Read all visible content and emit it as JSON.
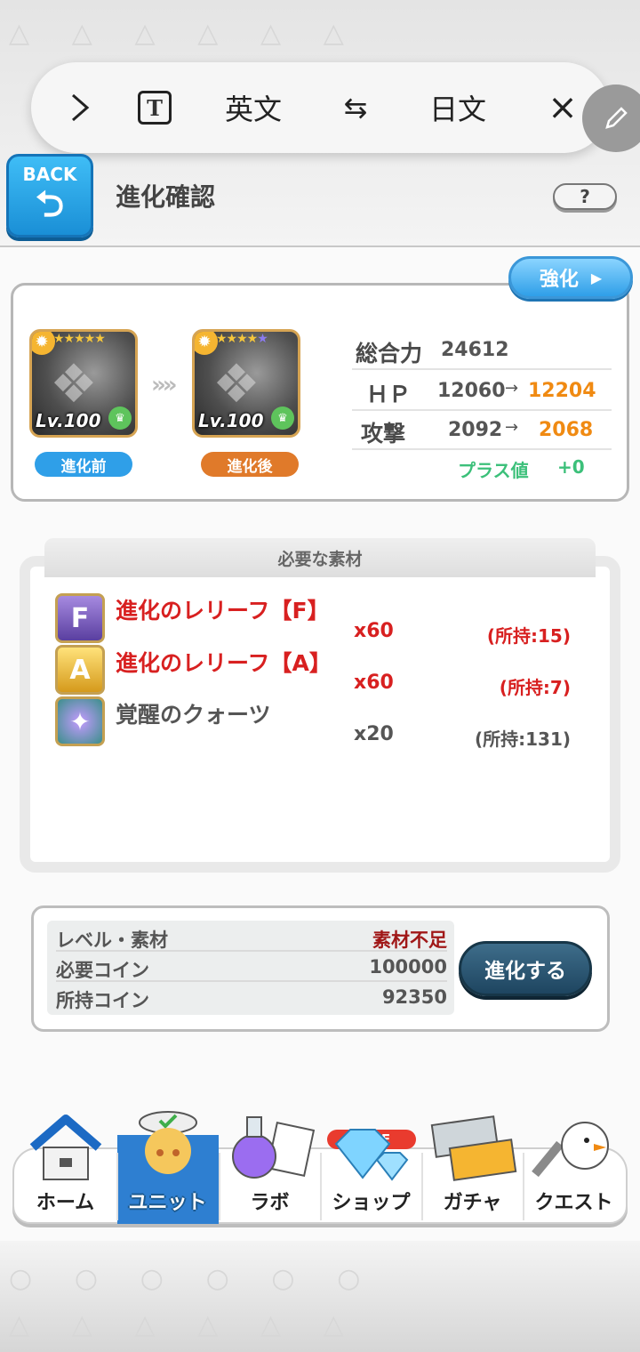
{
  "toolbar": {
    "expand_icon": "chevron-right-icon",
    "text_mode_icon": "T",
    "lang_source": "英文",
    "swap_icon": "⇆",
    "lang_target": "日文",
    "close_icon": "×",
    "edit_icon": "pencil-icon"
  },
  "header": {
    "back_label": "BACK",
    "title": "進化確認",
    "help_label": "?"
  },
  "evolution": {
    "enhance_label": "強化",
    "before": {
      "level": "Lv.100",
      "badge": "進化前"
    },
    "after": {
      "level": "Lv.100",
      "badge": "進化後"
    },
    "stats": {
      "total_label": "総合力",
      "total_value": "24612",
      "hp_label": "ＨＰ",
      "hp_old": "12060",
      "hp_new": "12204",
      "atk_label": "攻撃",
      "atk_old": "2092",
      "atk_new": "2068",
      "plus_label": "プラス値",
      "plus_value": "+0"
    }
  },
  "materials": {
    "header": "必要な素材",
    "items": [
      {
        "icon": "F",
        "name": "進化のレリーフ【F】",
        "qty": "x60",
        "owned": "(所持:15)"
      },
      {
        "icon": "A",
        "name": "進化のレリーフ【A】",
        "qty": "x60",
        "owned": "(所持:7)"
      },
      {
        "icon": "crystal-icon",
        "name": "覚醒のクォーツ",
        "qty": "x20",
        "owned": "(所持:131)"
      }
    ]
  },
  "coins": {
    "rows": [
      {
        "label": "レベル・素材",
        "value": "素材不足"
      },
      {
        "label": "必要コイン",
        "value": "100000"
      },
      {
        "label": "所持コイン",
        "value": "92350"
      }
    ],
    "evolve_button": "進化する"
  },
  "nav": {
    "items": [
      {
        "label": "ホーム",
        "icon": "house-icon"
      },
      {
        "label": "ユニット",
        "icon": "unit-character-icon"
      },
      {
        "label": "ラボ",
        "icon": "flask-icon"
      },
      {
        "label": "ショップ",
        "icon": "diamond-icon"
      },
      {
        "label": "ガチャ",
        "icon": "gacha-ticket-icon"
      },
      {
        "label": "クエスト",
        "icon": "bird-sword-icon"
      }
    ],
    "sale_badge": "SALE",
    "active": "ユニット"
  },
  "colors": {
    "accent_blue": "#2f9fe8",
    "highlight_orange": "#f08a12",
    "warning_red": "#d82020",
    "plus_green": "#3cc07a",
    "badge_before": "#2f9fe8",
    "badge_after": "#e07a2a"
  }
}
